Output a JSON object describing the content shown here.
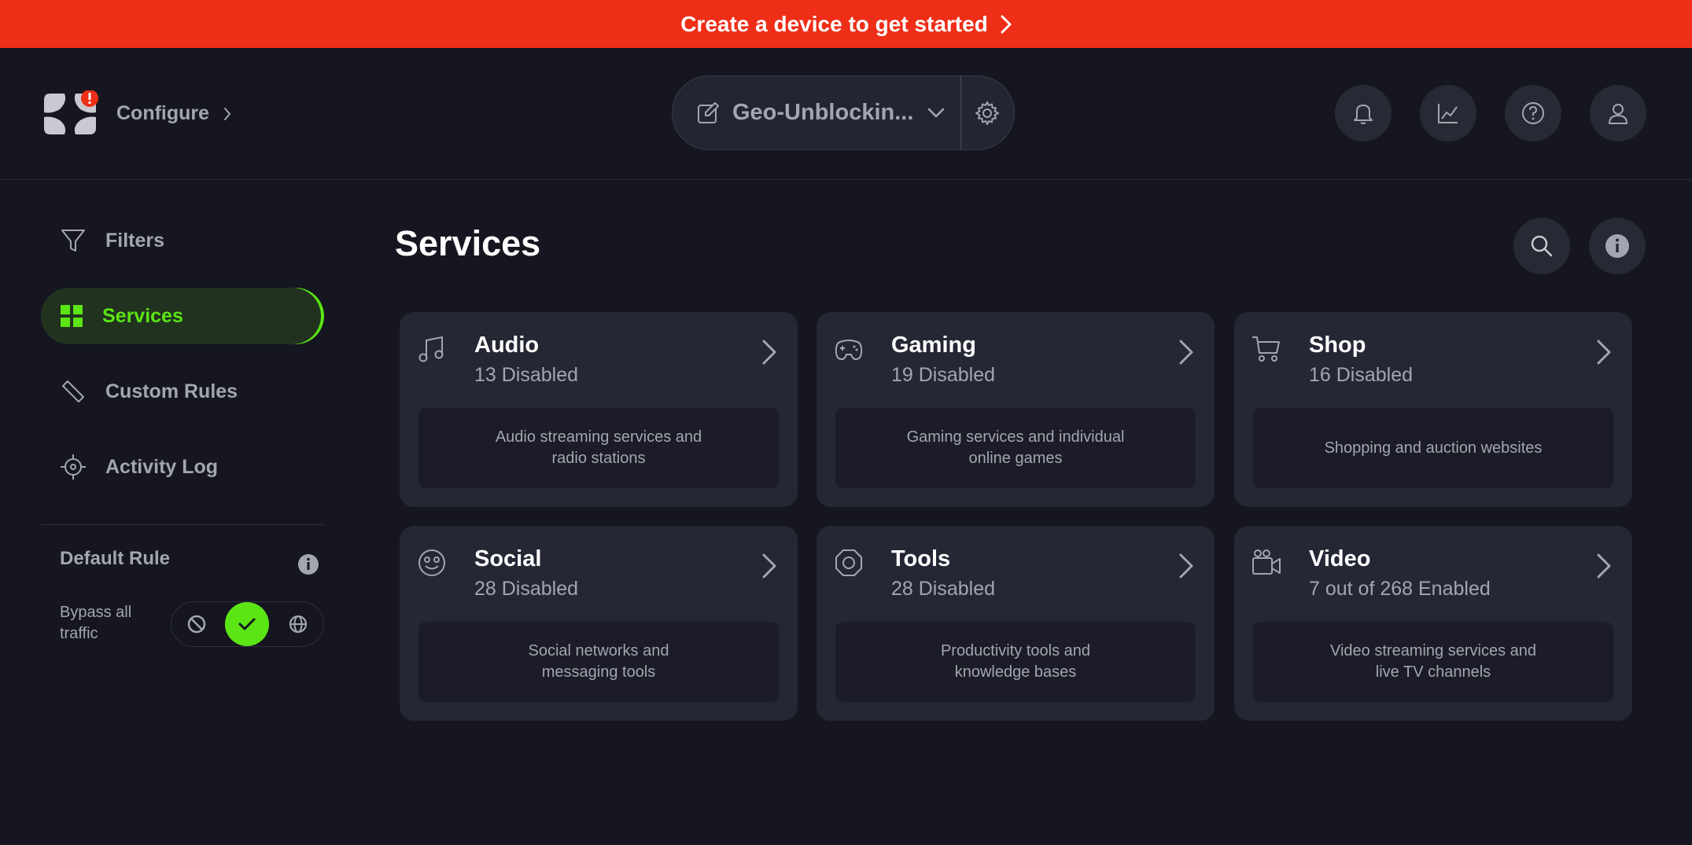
{
  "banner": {
    "text": "Create a device to get started"
  },
  "header": {
    "configure_label": "Configure",
    "profile_name": "Geo-Unblockin...",
    "buttons": [
      "bell-icon",
      "chart-icon",
      "help-icon",
      "user-icon"
    ]
  },
  "sidebar": {
    "items": [
      {
        "label": "Filters",
        "icon": "filter-icon"
      },
      {
        "label": "Services",
        "icon": "grid-icon",
        "active": true
      },
      {
        "label": "Custom Rules",
        "icon": "ruler-icon"
      },
      {
        "label": "Activity Log",
        "icon": "target-icon"
      }
    ],
    "default_rule": {
      "title": "Default Rule",
      "bypass_label": "Bypass all traffic",
      "options": [
        "block-icon",
        "check-icon",
        "globe-icon"
      ],
      "selected": "check-icon"
    }
  },
  "main": {
    "title": "Services",
    "cards": [
      {
        "title": "Audio",
        "count": "13 Disabled",
        "description": "Audio streaming services and radio stations",
        "icon": "music-note-icon"
      },
      {
        "title": "Gaming",
        "count": "19 Disabled",
        "description": "Gaming services and individual online games",
        "icon": "gamepad-icon"
      },
      {
        "title": "Shop",
        "count": "16 Disabled",
        "description": "Shopping and auction websites",
        "icon": "cart-icon"
      },
      {
        "title": "Social",
        "count": "28 Disabled",
        "description": "Social networks and messaging tools",
        "icon": "smiley-icon"
      },
      {
        "title": "Tools",
        "count": "28 Disabled",
        "description": "Productivity tools and knowledge bases",
        "icon": "nut-icon"
      },
      {
        "title": "Video",
        "count": "7 out of 268 Enabled",
        "description": "Video streaming services and live TV channels",
        "icon": "video-camera-icon"
      }
    ]
  },
  "colors": {
    "accent": "#5be514",
    "banner": "#ee2e17",
    "background": "#15161f",
    "card": "#252735"
  }
}
